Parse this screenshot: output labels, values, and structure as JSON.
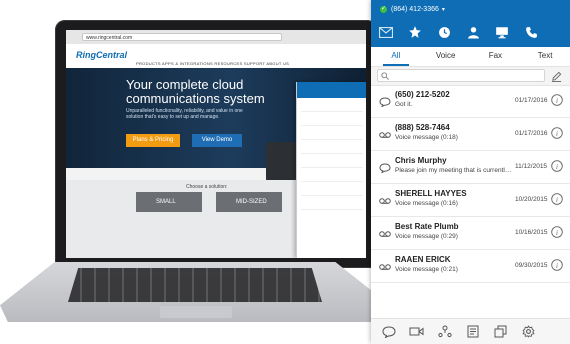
{
  "website": {
    "url": "www.ringcentral.com",
    "logo": "RingCentral",
    "nav": "PRODUCTS   APPS & INTEGRATIONS   RESOURCES   SUPPORT   ABOUT US",
    "hero_title": "Your complete cloud communications system",
    "hero_subtitle": "Unparalleled functionality, reliability, and value in one solution that's easy to set up and manage.",
    "btn_plans": "Plans & Pricing",
    "btn_demo": "View Demo",
    "choose": "Choose a solution:",
    "plan_small": "SMALL",
    "plan_mid": "MID-SIZED"
  },
  "app": {
    "phone_number": "(864) 412-3366",
    "nav_icons": [
      "mail-icon",
      "star-icon",
      "clock-icon",
      "user-icon",
      "monitor-icon",
      "phone-icon"
    ],
    "tabs": [
      "All",
      "Voice",
      "Fax",
      "Text"
    ],
    "active_tab": 0,
    "search_placeholder": "",
    "items": [
      {
        "type": "message",
        "name": "(650) 212-5202",
        "detail": "Got it.",
        "date": "01/17/2016"
      },
      {
        "type": "voicemail",
        "name": "(888) 528-7464",
        "detail": "Voice message (0:18)",
        "date": "01/17/2016"
      },
      {
        "type": "message",
        "name": "Chris Murphy",
        "detail": "Please join my meeting that is currently in p...",
        "date": "11/12/2015"
      },
      {
        "type": "voicemail",
        "name": "SHERELL HAYYES",
        "detail": "Voice message (0:16)",
        "date": "10/20/2015"
      },
      {
        "type": "voicemail",
        "name": "Best Rate Plumb",
        "detail": "Voice message (0:29)",
        "date": "10/16/2015"
      },
      {
        "type": "voicemail",
        "name": "RAAEN ERICK",
        "detail": "Voice message (0:21)",
        "date": "09/30/2015"
      }
    ],
    "bottom_icons": [
      "chat-icon",
      "video-icon",
      "conference-icon",
      "fax-icon",
      "copy-icon",
      "settings-icon"
    ],
    "colors": {
      "brand": "#0e6db5",
      "status": "#3fbf3f"
    }
  }
}
